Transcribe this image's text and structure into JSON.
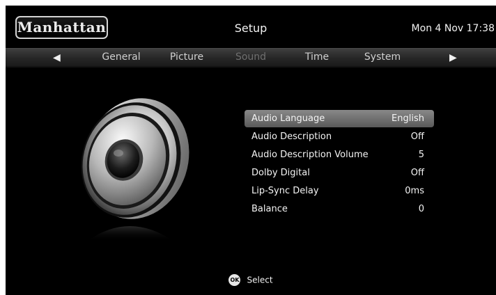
{
  "header": {
    "brand": "Manhattan",
    "title": "Setup",
    "datetime": "Mon 4 Nov 17:38"
  },
  "tabs": {
    "prev_icon": "left-triangle-icon",
    "next_icon": "right-triangle-icon",
    "items": [
      {
        "label": "General",
        "active": false
      },
      {
        "label": "Picture",
        "active": false
      },
      {
        "label": "Sound",
        "active": true
      },
      {
        "label": "Time",
        "active": false
      },
      {
        "label": "System",
        "active": false
      }
    ]
  },
  "menu": {
    "items": [
      {
        "label": "Audio Language",
        "value": "English",
        "selected": true
      },
      {
        "label": "Audio Description",
        "value": "Off",
        "selected": false
      },
      {
        "label": "Audio Description Volume",
        "value": "5",
        "selected": false
      },
      {
        "label": "Dolby Digital",
        "value": "Off",
        "selected": false
      },
      {
        "label": "Lip-Sync Delay",
        "value": "0ms",
        "selected": false
      },
      {
        "label": "Balance",
        "value": "0",
        "selected": false
      }
    ]
  },
  "footer": {
    "ok_icon_text": "OK",
    "ok_label": "Select"
  },
  "colors": {
    "background": "#000000",
    "highlight": "#7a7a7a",
    "inactive_tab": "#6f6f6f",
    "text": "#f4f4f4"
  }
}
